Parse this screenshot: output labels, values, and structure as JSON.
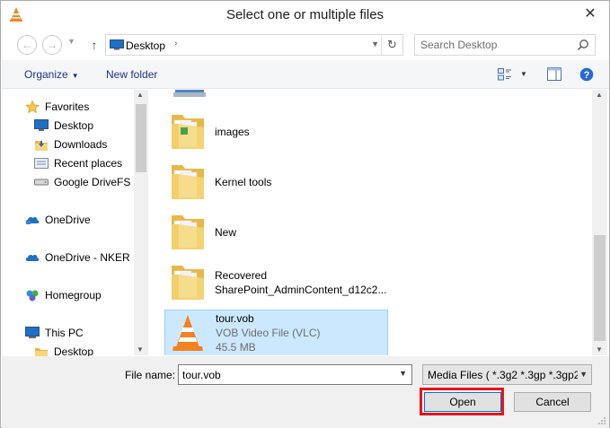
{
  "window": {
    "title": "Select one or multiple files",
    "close_glyph": "✕"
  },
  "address": {
    "path": "Desktop",
    "search_placeholder": "Search Desktop"
  },
  "toolbar": {
    "organize_label": "Organize",
    "new_folder_label": "New folder"
  },
  "nav": {
    "favorites_label": "Favorites",
    "favorites": [
      {
        "label": "Desktop",
        "icon": "desktop-icon"
      },
      {
        "label": "Downloads",
        "icon": "downloads-icon"
      },
      {
        "label": "Recent places",
        "icon": "recent-places-icon"
      },
      {
        "label": "Google DriveFS",
        "icon": "drive-icon"
      }
    ],
    "onedrive_label": "OneDrive",
    "onedrive_nker_label": "OneDrive - NKER",
    "homegroup_label": "Homegroup",
    "thispc_label": "This PC",
    "thispc_children": [
      {
        "label": "Desktop",
        "icon": "folder-icon"
      }
    ]
  },
  "files": [
    {
      "name": "images",
      "icon": "folder-icon"
    },
    {
      "name": "Kernel tools",
      "icon": "folder-icon"
    },
    {
      "name": "New",
      "icon": "folder-icon"
    },
    {
      "name": "Recovered",
      "name2": "SharePoint_AdminContent_d12c2...",
      "icon": "folder-icon"
    },
    {
      "name": "tour.vob",
      "type": "VOB Video File (VLC)",
      "size": "45.5 MB",
      "icon": "vlc-icon",
      "selected": true
    }
  ],
  "bottom": {
    "file_name_label": "File name:",
    "file_name_value": "tour.vob",
    "file_type": "Media Files ( *.3g2 *.3gp *.3gp2",
    "open_label": "Open",
    "cancel_label": "Cancel"
  },
  "colors": {
    "accent": "#1e3287",
    "selection": "#cce8ff",
    "selection_border": "#99d1ff",
    "highlight": "#e8141c",
    "folder": "#f0c95c"
  }
}
